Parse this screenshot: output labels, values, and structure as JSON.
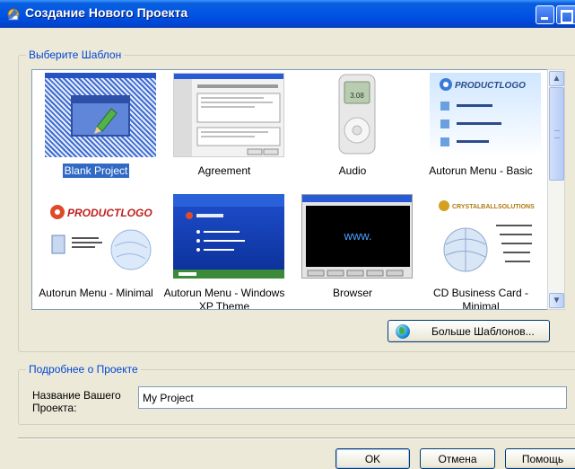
{
  "window": {
    "title": "Создание Нового Проекта"
  },
  "templates_group": {
    "legend": "Выберите Шаблон",
    "items": [
      {
        "label": "Blank Project",
        "selected": true
      },
      {
        "label": "Agreement",
        "selected": false
      },
      {
        "label": "Audio",
        "selected": false,
        "screen_text": "3.08"
      },
      {
        "label": "Autorun Menu - Basic",
        "selected": false,
        "logo_text": "PRODUCTLOGO"
      },
      {
        "label": "Autorun Menu - Minimal",
        "selected": false,
        "logo_text": "PRODUCTLOGO"
      },
      {
        "label": "Autorun Menu - Windows XP Theme",
        "selected": false
      },
      {
        "label": "Browser",
        "selected": false,
        "screen_text": "www."
      },
      {
        "label": "CD Business Card - Minimal",
        "selected": false,
        "logo_text": "CRYSTALBALLSOLUTIONS"
      }
    ],
    "more_button": "Больше Шаблонов..."
  },
  "details_group": {
    "legend": "Подробнее о Проекте",
    "name_label": "Название Вашего Проекта:",
    "name_value": "My Project"
  },
  "buttons": {
    "ok": "OK",
    "cancel": "Отмена",
    "help": "Помощь"
  },
  "colors": {
    "title_bar": "#0055e5",
    "selection": "#316ac5",
    "group_legend": "#0046d5"
  }
}
